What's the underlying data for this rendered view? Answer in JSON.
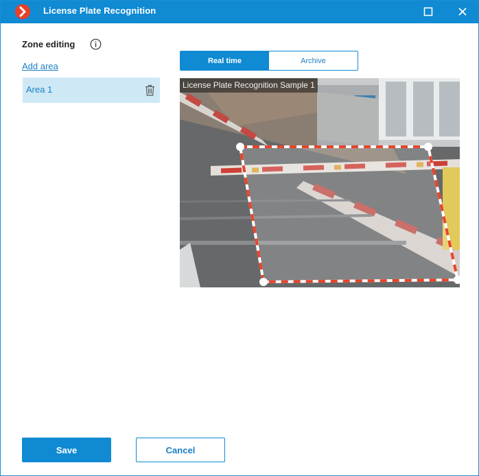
{
  "window": {
    "title": "License Plate Recognition",
    "icons": {
      "logo": "app-logo-icon",
      "maximize": "maximize-icon",
      "close": "close-icon"
    }
  },
  "zone_panel": {
    "title": "Zone editing",
    "info_icon": "info-icon",
    "add_area_label": "Add area",
    "areas": [
      {
        "label": "Area 1",
        "delete_icon": "trash-icon"
      }
    ]
  },
  "tabs": [
    {
      "label": "Real time",
      "active": true
    },
    {
      "label": "Archive",
      "active": false
    }
  ],
  "camera": {
    "label": "License Plate Recognition Sample 1"
  },
  "buttons": {
    "save": "Save",
    "cancel": "Cancel"
  },
  "colors": {
    "accent": "#0f8ad3",
    "selected_item": "#cfe8f6",
    "zone_outline": "#e8442a",
    "logo": "#e8402b"
  }
}
